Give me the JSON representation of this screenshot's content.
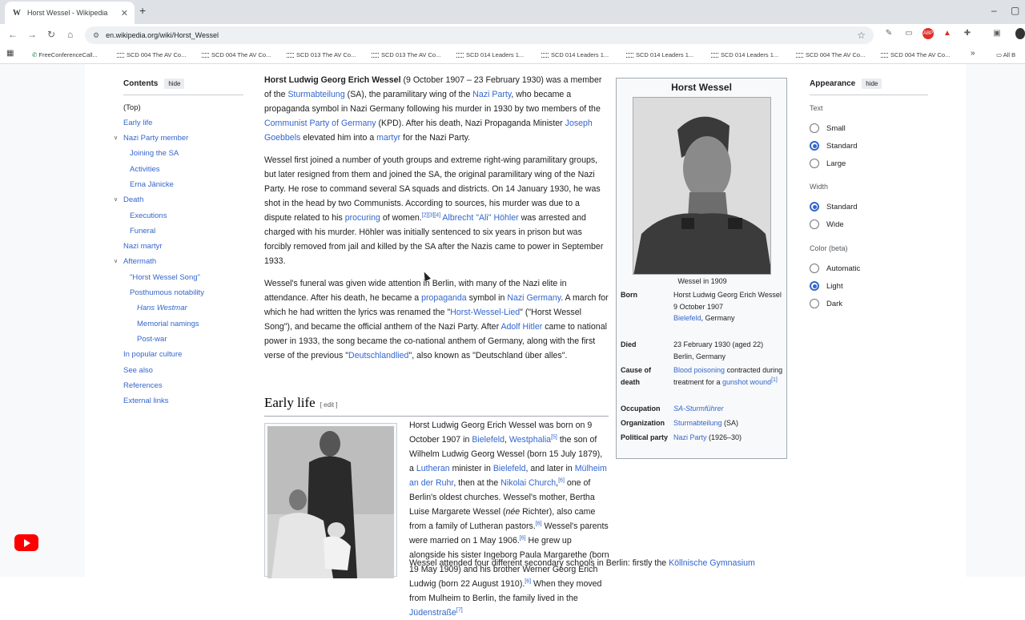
{
  "browser": {
    "tab_title": "Horst Wessel - Wikipedia",
    "tab_favicon": "W",
    "url": "en.wikipedia.org/wiki/Horst_Wessel",
    "bookmarks": [
      "FreeConferenceCall...",
      "SCD 004 The AV Co...",
      "SCD 004 The AV Co...",
      "SCD 013 The AV Co...",
      "SCD 013 The AV Co...",
      "SCD 014 Leaders 1...",
      "SCD 014 Leaders 1...",
      "SCD 014 Leaders 1...",
      "SCD 014 Leaders 1...",
      "SCD 004 The AV Co...",
      "SCD 004 The AV Co..."
    ],
    "all_bookmarks": "All B"
  },
  "toc": {
    "title": "Contents",
    "hide": "hide",
    "items": [
      "(Top)",
      "Early life",
      "Nazi Party member",
      "Joining the SA",
      "Activities",
      "Erna Jänicke",
      "Death",
      "Executions",
      "Funeral",
      "Nazi martyr",
      "Aftermath",
      "\"Horst Wessel Song\"",
      "Posthumous notability",
      "Hans Westmar",
      "Memorial namings",
      "Post-war",
      "In popular culture",
      "See also",
      "References",
      "External links"
    ]
  },
  "article": {
    "p1": {
      "bold": "Horst Ludwig Georg Erich Wessel",
      "t1": " (9 October 1907 – 23 February 1930) was a member of the ",
      "l1": "Sturmabteilung",
      "t2": " (SA), the paramilitary wing of the ",
      "l2": "Nazi Party",
      "t3": ", who became a propaganda symbol in Nazi Germany following his murder in 1930 by two members of the ",
      "l3": "Communist Party of Germany",
      "t4": " (KPD). After his death, Nazi Propaganda Minister ",
      "l4": "Joseph Goebbels",
      "t5": " elevated him into a ",
      "l5": "martyr",
      "t6": " for the Nazi Party."
    },
    "p2": {
      "t1": "Wessel first joined a number of youth groups and extreme right-wing paramilitary groups, but later resigned from them and joined the SA, the original paramilitary wing of the Nazi Party. He rose to command several SA squads and districts. On 14 January 1930, he was shot in the head by two Communists. According to sources, his murder was due to a dispute related to his ",
      "l1": "procuring",
      "t2": " of women.",
      "r1": "[2][3][4]",
      "l2": "Albrecht \"Ali\" Höhler",
      "t3": " was arrested and charged with his murder. Höhler was initially sentenced to six years in prison but was forcibly removed from jail and killed by the SA after the Nazis came to power in September 1933."
    },
    "p3": {
      "t1": "Wessel's funeral was given wide attention in Berlin, with many of the Nazi elite in attendance. After his death, he became a ",
      "l1": "propaganda",
      "t2": " symbol in ",
      "l2": "Nazi Germany",
      "t3": ". A march for which he had written the lyrics was renamed the \"",
      "l3": "Horst-Wessel-Lied",
      "t4": "\" (\"Horst Wessel Song\"), and became the official anthem of the Nazi Party. After ",
      "l4": "Adolf Hitler",
      "t5": " came to national power in 1933, the song became the co-national anthem of Germany, along with the first verse of the previous \"",
      "l5": "Deutschlandlied",
      "t6": "\", also known as \"Deutschland über alles\"."
    },
    "section_title": "Early life",
    "section_edit": "[ edit ]",
    "p4": {
      "t1": "Horst Ludwig Georg Erich Wessel was born on 9 October 1907 in ",
      "l1": "Bielefeld",
      "t1b": ", ",
      "l2": "Westphalia",
      "r1": "[5]",
      "t2": " the son of Wilhelm Ludwig Georg Wessel (born 15 July 1879), a ",
      "l3": "Lutheran",
      "t3": " minister in ",
      "l4": "Bielefeld",
      "t4": ", and later in ",
      "l5": "Mülheim an der Ruhr",
      "t5": ", then at the ",
      "l6": "Nikolai Church",
      "t5b": ",",
      "r2": "[6]",
      "t6": " one of Berlin's oldest churches. Wessel's mother, Bertha Luise Margarete Wessel (",
      "i1": "née",
      "t7": " Richter), also came from a family of Lutheran pastors.",
      "r3": "[6]",
      "t8": " Wessel's parents were married on 1 May 1906.",
      "r4": "[6]",
      "t9": " He grew up alongside his sister Ingeborg Paula Margarethe (born 19 May 1909) and his brother Werner Georg Erich Ludwig (born 22 August 1910).",
      "r5": "[6]",
      "t10": " When they moved from Mulheim to Berlin, the family lived in the ",
      "l7": "Jüdenstraße",
      "r6": "[7]"
    },
    "p5": {
      "t1": "Wessel attended four different secondary schools in Berlin: firstly the ",
      "l1": "Köllnische Gymnasium"
    }
  },
  "infobox": {
    "title": "Horst Wessel",
    "caption": "Wessel in 1909",
    "rows": [
      {
        "label": "Born",
        "v1": "Horst Ludwig Georg Erich Wessel",
        "v2": "9 October 1907",
        "link": "Bielefeld",
        "v3": ", Germany"
      },
      {
        "label": "Died",
        "v1": "23 February 1930 (aged 22)",
        "v2": "Berlin, Germany"
      },
      {
        "label": "Cause of death",
        "link1": "Blood poisoning",
        "t1": " contracted during treatment for a ",
        "link2": "gunshot wound",
        "ref": "[1]"
      },
      {
        "label": "Occupation",
        "link": "SA-Sturmführer"
      },
      {
        "label": "Organization",
        "link": "Sturmabteilung",
        "t1": " (SA)"
      },
      {
        "label": "Political party",
        "link": "Nazi Party",
        "t1": " (1926–30)"
      }
    ]
  },
  "appearance": {
    "title": "Appearance",
    "hide": "hide",
    "text_label": "Text",
    "text_options": [
      "Small",
      "Standard",
      "Large"
    ],
    "text_selected": "Standard",
    "width_label": "Width",
    "width_options": [
      "Standard",
      "Wide"
    ],
    "width_selected": "Standard",
    "color_label": "Color (beta)",
    "color_options": [
      "Automatic",
      "Light",
      "Dark"
    ],
    "color_selected": "Light"
  }
}
